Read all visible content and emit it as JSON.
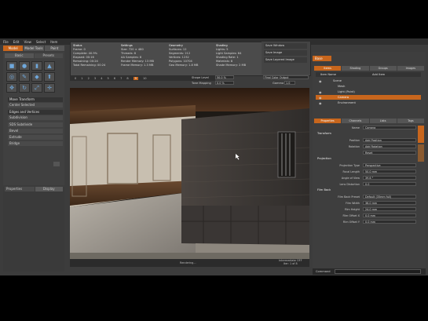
{
  "menubar": [
    "File",
    "Edit",
    "View",
    "Select",
    "Item"
  ],
  "mode_tabs": [
    {
      "label": "Model",
      "active": true
    },
    {
      "label": "Model Tools",
      "active": false
    },
    {
      "label": "Paint",
      "active": false
    }
  ],
  "left_toolbar": {
    "tabs": [
      "Basic",
      "Presets"
    ],
    "rows": [
      {
        "label": "Move Transform",
        "head": true
      },
      {
        "label": "Center Selected",
        "head": false
      },
      {
        "label": "Edges and Vertices",
        "head": true
      },
      {
        "label": "Subdivision",
        "head": false
      },
      {
        "label": "SDS Subdivide",
        "head": false
      },
      {
        "label": "Bevel",
        "head": false
      },
      {
        "label": "Extrude",
        "head": false
      },
      {
        "label": "Bridge",
        "head": false
      }
    ],
    "bottom_tabs": [
      "Properties",
      "Display"
    ]
  },
  "info_panel": {
    "col1": [
      "Status",
      "Frame: 0",
      "Complete: 40.9%",
      "Elapsed: 00:16",
      "Remaining: 00:24",
      "Total Remaining: 00:24"
    ],
    "col2": [
      "Settings",
      "Size: 720 × 480",
      "Threads: 8",
      "AA Samples: 8",
      "Render Memory: 13 MB",
      "Frame Memory: 1.3 MB"
    ],
    "col3": [
      "Geometry",
      "Surfaces: 12",
      "Segments: 212",
      "Vertices: 1232",
      "Polygons: 10704",
      "Geo Memory: 1.8 MB"
    ],
    "col4": [
      "Shading",
      "Lights: 5",
      "Light Samples: 64",
      "Shading Rate: 1",
      "Materials: 8",
      "Shade Memory: 2 MB"
    ],
    "side_items": [
      "Save Window",
      "Save Image",
      "Save Layered Image"
    ]
  },
  "timeline": {
    "frames": [
      "0",
      "1",
      "2",
      "3",
      "4",
      "5",
      "6",
      "7",
      "8",
      "9",
      "10"
    ],
    "current": "9"
  },
  "render_controls": {
    "shape_label": "Shape Level",
    "shape_value": "50.0 %",
    "tone_label": "Tone Mapping",
    "tone_value": "0.0 %",
    "preset_label": "Final Color Output",
    "gamma_label": "Gamma",
    "gamma_value": "1.0"
  },
  "viewport_status": {
    "left": "Rendering...",
    "right1": "Intermediate OFF",
    "right2": "Iter: 1 of 8",
    "right3": "0.0 %"
  },
  "right_panel": {
    "top_dropdown": "Base",
    "tabs1": [
      {
        "label": "Items",
        "active": true
      },
      {
        "label": "Shading",
        "active": false
      },
      {
        "label": "Groups",
        "active": false
      },
      {
        "label": "Images",
        "active": false
      }
    ],
    "tree_header": [
      "Item Name",
      "Add Item"
    ],
    "tree": [
      {
        "label": "Scene",
        "indent": 0,
        "selected": false
      },
      {
        "label": "Mesh",
        "indent": 1,
        "selected": false
      },
      {
        "label": "Light (Point)",
        "indent": 1,
        "selected": false
      },
      {
        "label": "Camera",
        "indent": 1,
        "selected": true
      },
      {
        "label": "Environment",
        "indent": 1,
        "selected": false
      }
    ],
    "tabs2": [
      {
        "label": "Properties",
        "active": true
      },
      {
        "label": "Channels",
        "active": false
      },
      {
        "label": "Lists",
        "active": false
      },
      {
        "label": "Tags",
        "active": false
      }
    ],
    "props": [
      {
        "type": "field",
        "label": "Name",
        "value": "Camera"
      },
      {
        "type": "section",
        "label": "Transform"
      },
      {
        "type": "field",
        "label": "Position",
        "value": "Add Position"
      },
      {
        "type": "field",
        "label": "Rotation",
        "value": "Add Rotation"
      },
      {
        "type": "field",
        "label": "",
        "value": "Reset"
      },
      {
        "type": "section",
        "label": "Projection"
      },
      {
        "type": "field",
        "label": "Projection Type",
        "value": "Perspective"
      },
      {
        "type": "field",
        "label": "Focal Length",
        "value": "50.0 mm"
      },
      {
        "type": "field",
        "label": "Angle of View",
        "value": "39.6 °"
      },
      {
        "type": "field",
        "label": "Lens Distortion",
        "value": "0.0"
      },
      {
        "type": "section",
        "label": "Film Back"
      },
      {
        "type": "field",
        "label": "Film Back Preset",
        "value": "Default (35mm full)"
      },
      {
        "type": "field",
        "label": "Film Width",
        "value": "36.0 mm"
      },
      {
        "type": "field",
        "label": "Film Height",
        "value": "24.0 mm"
      },
      {
        "type": "field",
        "label": "Film Offset X",
        "value": "0.0 mm"
      },
      {
        "type": "field",
        "label": "Film Offset Y",
        "value": "0.0 mm"
      }
    ],
    "command_label": "Command"
  },
  "colors": {
    "accent": "#c8661d",
    "panel": "#3e3e3e",
    "dark": "#2b2b2b"
  }
}
